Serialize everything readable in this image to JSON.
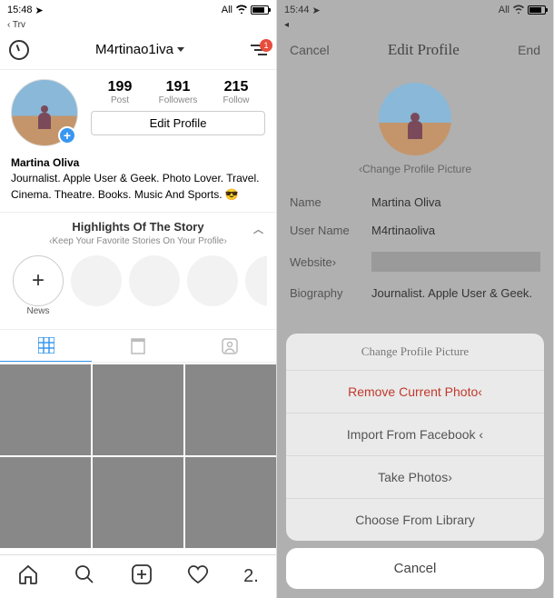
{
  "left": {
    "status": {
      "time": "15:48",
      "carrier_sub": "‹ Trv",
      "right_text": "All"
    },
    "nav": {
      "username": "M4rtinao1iva",
      "badge": "1"
    },
    "stats": {
      "posts": {
        "num": "199",
        "label": "Post"
      },
      "followers": {
        "num": "191",
        "label": "Followers"
      },
      "following": {
        "num": "215",
        "label": "Follow"
      }
    },
    "edit_profile": "Edit Profile",
    "bio": {
      "name": "Martina Oliva",
      "text": "Journalist. Apple User & Geek. Photo Lover. Travel. Cinema. Theatre. Books. Music And Sports. 😎"
    },
    "stories": {
      "title": "Highlights Of The Story",
      "subtitle": "‹Keep Your Favorite Stories On Your Profile›",
      "new_label": "News"
    },
    "bottom": {
      "profile_count": "2."
    }
  },
  "right": {
    "status": {
      "time": "15:44",
      "carrier_sub": "◂",
      "right_text": "All"
    },
    "nav": {
      "cancel": "Cancel",
      "title": "Edit Profile",
      "end": "End"
    },
    "change_link": "‹Change Profile Picture",
    "form": {
      "name": {
        "label": "Name",
        "value": "Martina Oliva"
      },
      "username": {
        "label": "User Name",
        "value": "M4rtinaoliva"
      },
      "website": {
        "label": "Website›"
      },
      "bio": {
        "label": "Biography",
        "value": "Journalist. Apple User & Geek."
      }
    },
    "sheet": {
      "title": "Change Profile Picture",
      "remove": "Remove Current Photo‹",
      "facebook": "Import From Facebook ‹",
      "take": "Take Photos›",
      "library": "Choose From Library",
      "cancel": "Cancel"
    }
  }
}
